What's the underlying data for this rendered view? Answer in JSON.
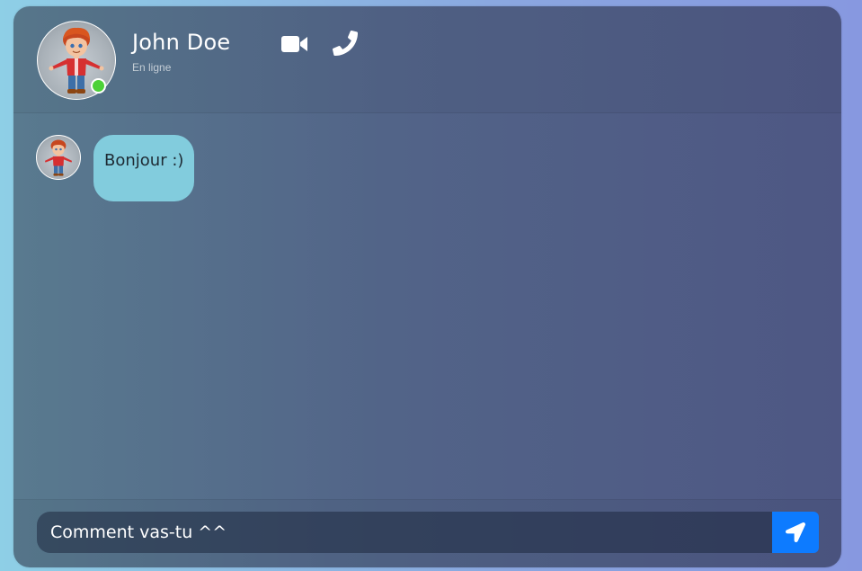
{
  "contact": {
    "name": "John Doe",
    "status": "En ligne",
    "avatar": "cartoon-boy-avatar",
    "online_color": "#4cd137"
  },
  "header_actions": [
    {
      "icon": "video-camera-icon"
    },
    {
      "icon": "phone-icon"
    }
  ],
  "messages": [
    {
      "sender": "contact",
      "avatar": "cartoon-boy-avatar",
      "text": "Bonjour :)",
      "bubble_color": "#82ccdd"
    }
  ],
  "composer": {
    "value": "Comment vas-tu ^^",
    "send_icon": "paper-plane-icon",
    "send_color": "#0d7bff"
  }
}
